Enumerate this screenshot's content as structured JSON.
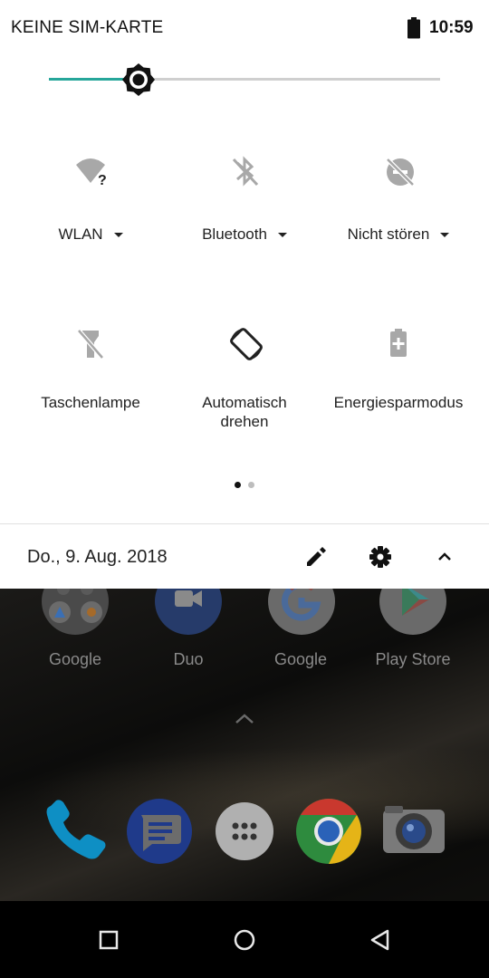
{
  "status_bar": {
    "carrier": "KEINE SIM-KARTE",
    "time": "10:59",
    "battery_icon": "battery-full-icon"
  },
  "brightness": {
    "level_percent": 23,
    "icon": "brightness-icon",
    "accent": "#26a69a"
  },
  "tiles": [
    {
      "label": "WLAN",
      "icon": "wifi-unknown-icon",
      "has_dropdown": true
    },
    {
      "label": "Bluetooth",
      "icon": "bluetooth-off-icon",
      "has_dropdown": true
    },
    {
      "label": "Nicht stören",
      "icon": "do-not-disturb-off-icon",
      "has_dropdown": true
    },
    {
      "label": "Taschenlampe",
      "icon": "flashlight-off-icon",
      "has_dropdown": false
    },
    {
      "label_line1": "Automatisch",
      "label_line2": "drehen",
      "icon": "auto-rotate-icon",
      "has_dropdown": false
    },
    {
      "label": "Energiesparmodus",
      "icon": "battery-saver-icon",
      "has_dropdown": false
    }
  ],
  "pager": {
    "pages": 2,
    "current": 1
  },
  "footer": {
    "date": "Do., 9. Aug. 2018",
    "edit_icon": "edit-icon",
    "settings_icon": "settings-icon",
    "collapse_icon": "chevron-up-icon"
  },
  "home": {
    "apps": [
      {
        "label": "Google",
        "icon": "google-folder-icon"
      },
      {
        "label": "Duo",
        "icon": "duo-icon"
      },
      {
        "label": "Google",
        "icon": "google-icon"
      },
      {
        "label": "Play Store",
        "icon": "play-store-icon"
      }
    ],
    "dock": [
      "phone-icon",
      "messages-icon",
      "app-drawer-icon",
      "chrome-icon",
      "camera-icon"
    ]
  },
  "navbar": {
    "buttons": [
      "recents-icon",
      "home-icon",
      "back-icon"
    ]
  }
}
